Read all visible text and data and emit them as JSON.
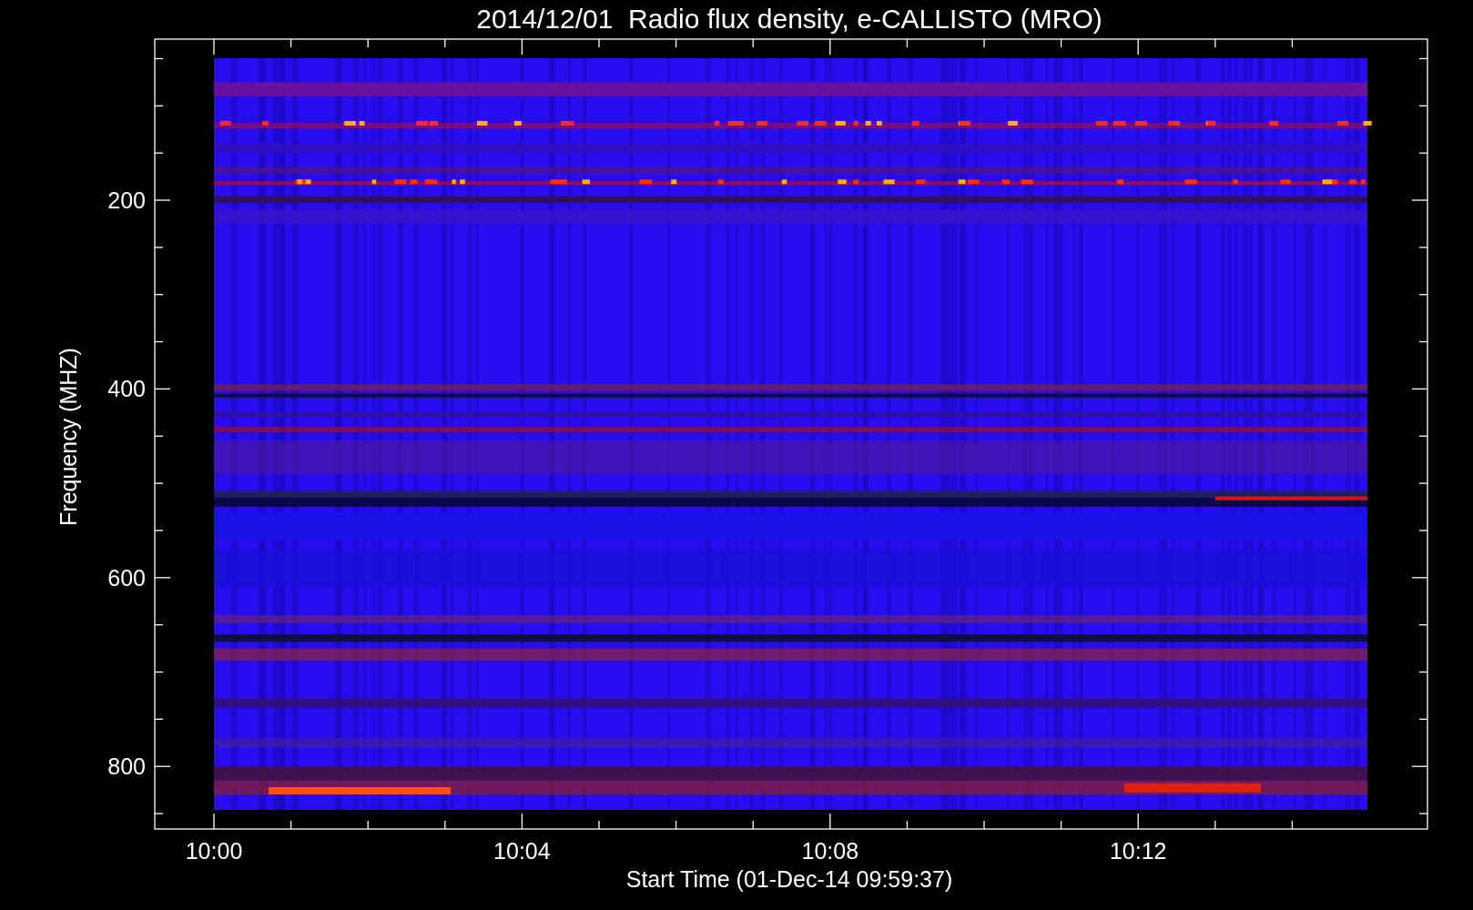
{
  "title": "2014/12/01  Radio flux density, e-CALLISTO (MRO)",
  "y_axis": {
    "label": "Frequency (MHZ)",
    "ticks": [
      "200",
      "400",
      "600",
      "800"
    ]
  },
  "x_axis": {
    "label": "Start Time (01-Dec-14 09:59:37)",
    "ticks": [
      "10:00",
      "10:04",
      "10:08",
      "10:12"
    ]
  }
}
